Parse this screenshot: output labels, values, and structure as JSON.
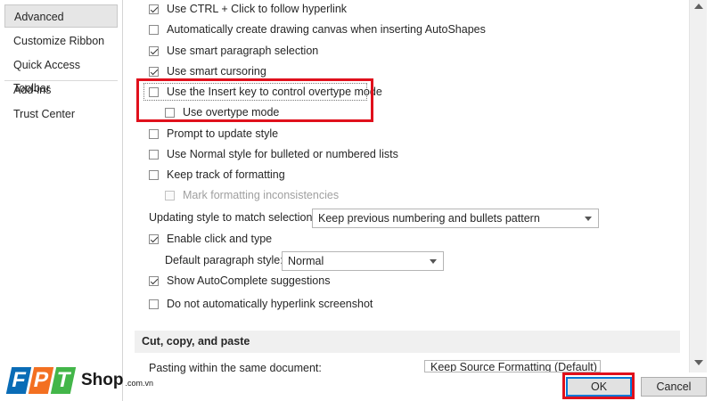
{
  "sidebar": {
    "items": [
      {
        "label": "Advanced"
      },
      {
        "label": "Customize Ribbon"
      },
      {
        "label": "Quick Access Toolbar"
      },
      {
        "label": "Add-ins"
      },
      {
        "label": "Trust Center"
      }
    ]
  },
  "options": {
    "ctrl_click": "Use CTRL + Click to follow hyperlink",
    "drawing_canvas": "Automatically create drawing canvas when inserting AutoShapes",
    "smart_paragraph": "Use smart paragraph selection",
    "smart_cursoring": "Use smart cursoring",
    "insert_key": "Use the Insert key to control overtype mode",
    "overtype_mode": "Use overtype mode",
    "prompt_update_style": "Prompt to update style",
    "normal_style_lists": "Use Normal style for bulleted or numbered lists",
    "keep_track_formatting": "Keep track of formatting",
    "mark_inconsistencies": "Mark formatting inconsistencies",
    "updating_style_label": "Updating style to match selection:",
    "updating_style_value": "Keep previous numbering and bullets pattern",
    "click_and_type": "Enable click and type",
    "default_para_label": "Default paragraph style:",
    "default_para_value": "Normal",
    "autocomplete": "Show AutoComplete suggestions",
    "no_auto_hyperlink": "Do not automatically hyperlink screenshot"
  },
  "section": {
    "title": "Cut, copy, and paste",
    "pasting_label": "Pasting within the same document:",
    "pasting_value": "Keep Source Formatting (Default)"
  },
  "buttons": {
    "ok": "OK",
    "cancel": "Cancel"
  },
  "logo": {
    "letters": [
      "F",
      "P",
      "T"
    ],
    "shop": "Shop",
    "domain": ".com.vn"
  },
  "colors": {
    "highlight": "#e0101c",
    "fpt_blue": "#0a6cb6",
    "fpt_orange": "#f37021",
    "fpt_green": "#43b649"
  }
}
